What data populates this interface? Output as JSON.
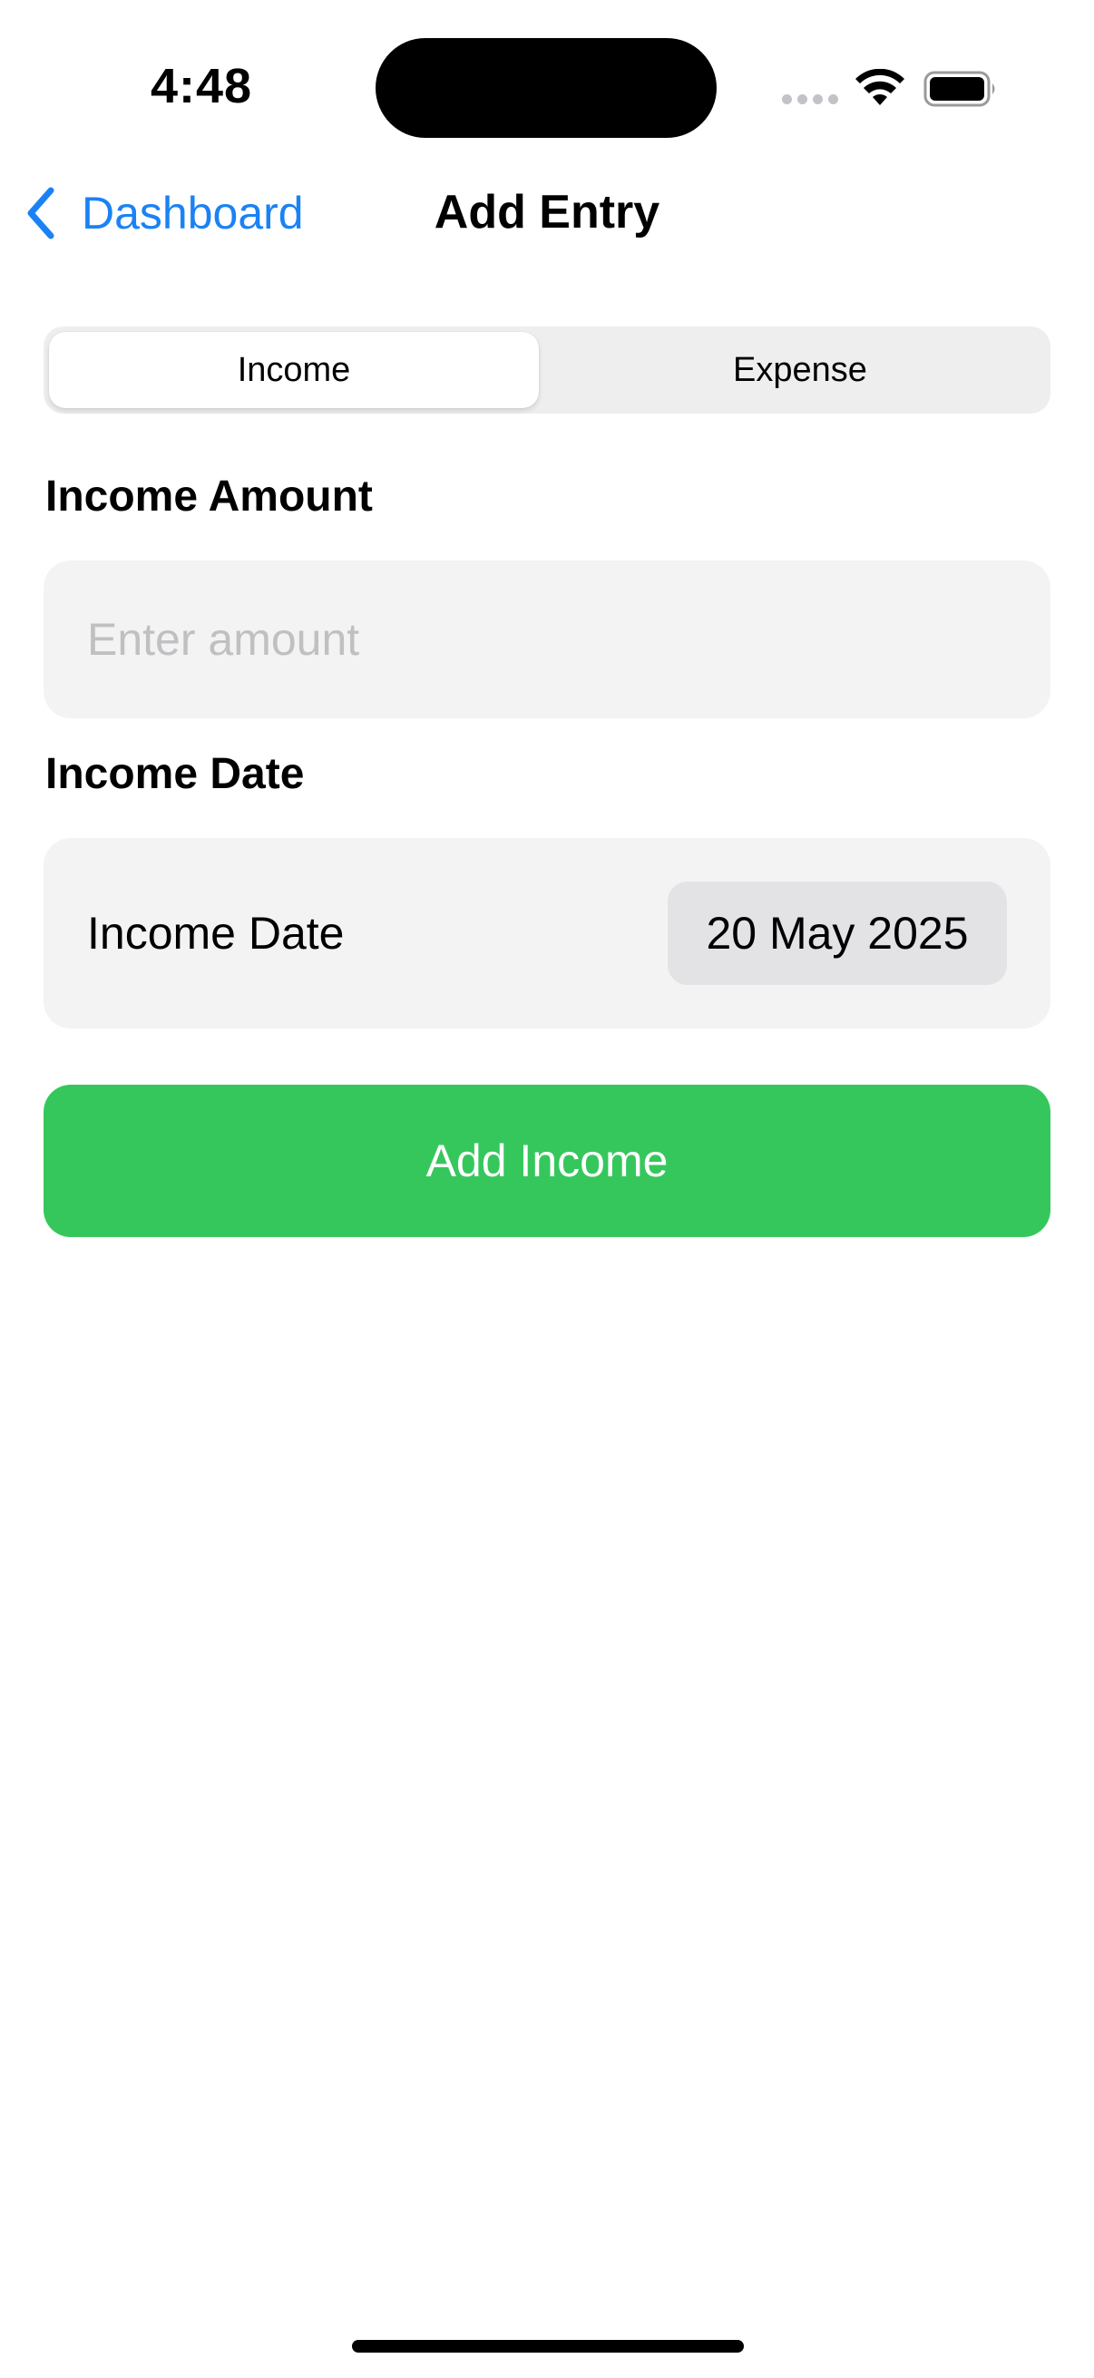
{
  "status_bar": {
    "time": "4:48"
  },
  "nav": {
    "back_label": "Dashboard",
    "title": "Add Entry"
  },
  "segmented": {
    "options": [
      "Income",
      "Expense"
    ],
    "selected": "Income"
  },
  "form": {
    "amount_section_label": "Income Amount",
    "amount_placeholder": "Enter amount",
    "amount_value": "",
    "date_section_label": "Income Date",
    "date_row_label": "Income Date",
    "date_value": "20 May 2025",
    "submit_label": "Add Income"
  },
  "colors": {
    "accent_blue": "#1a82f5",
    "submit_green": "#36c75c",
    "field_background": "#f3f3f3",
    "segment_background": "#eeeeef"
  },
  "icons": {
    "back": "chevron-left-icon",
    "signal": "cellular-signal-icon",
    "wifi": "wifi-icon",
    "battery": "battery-icon"
  }
}
